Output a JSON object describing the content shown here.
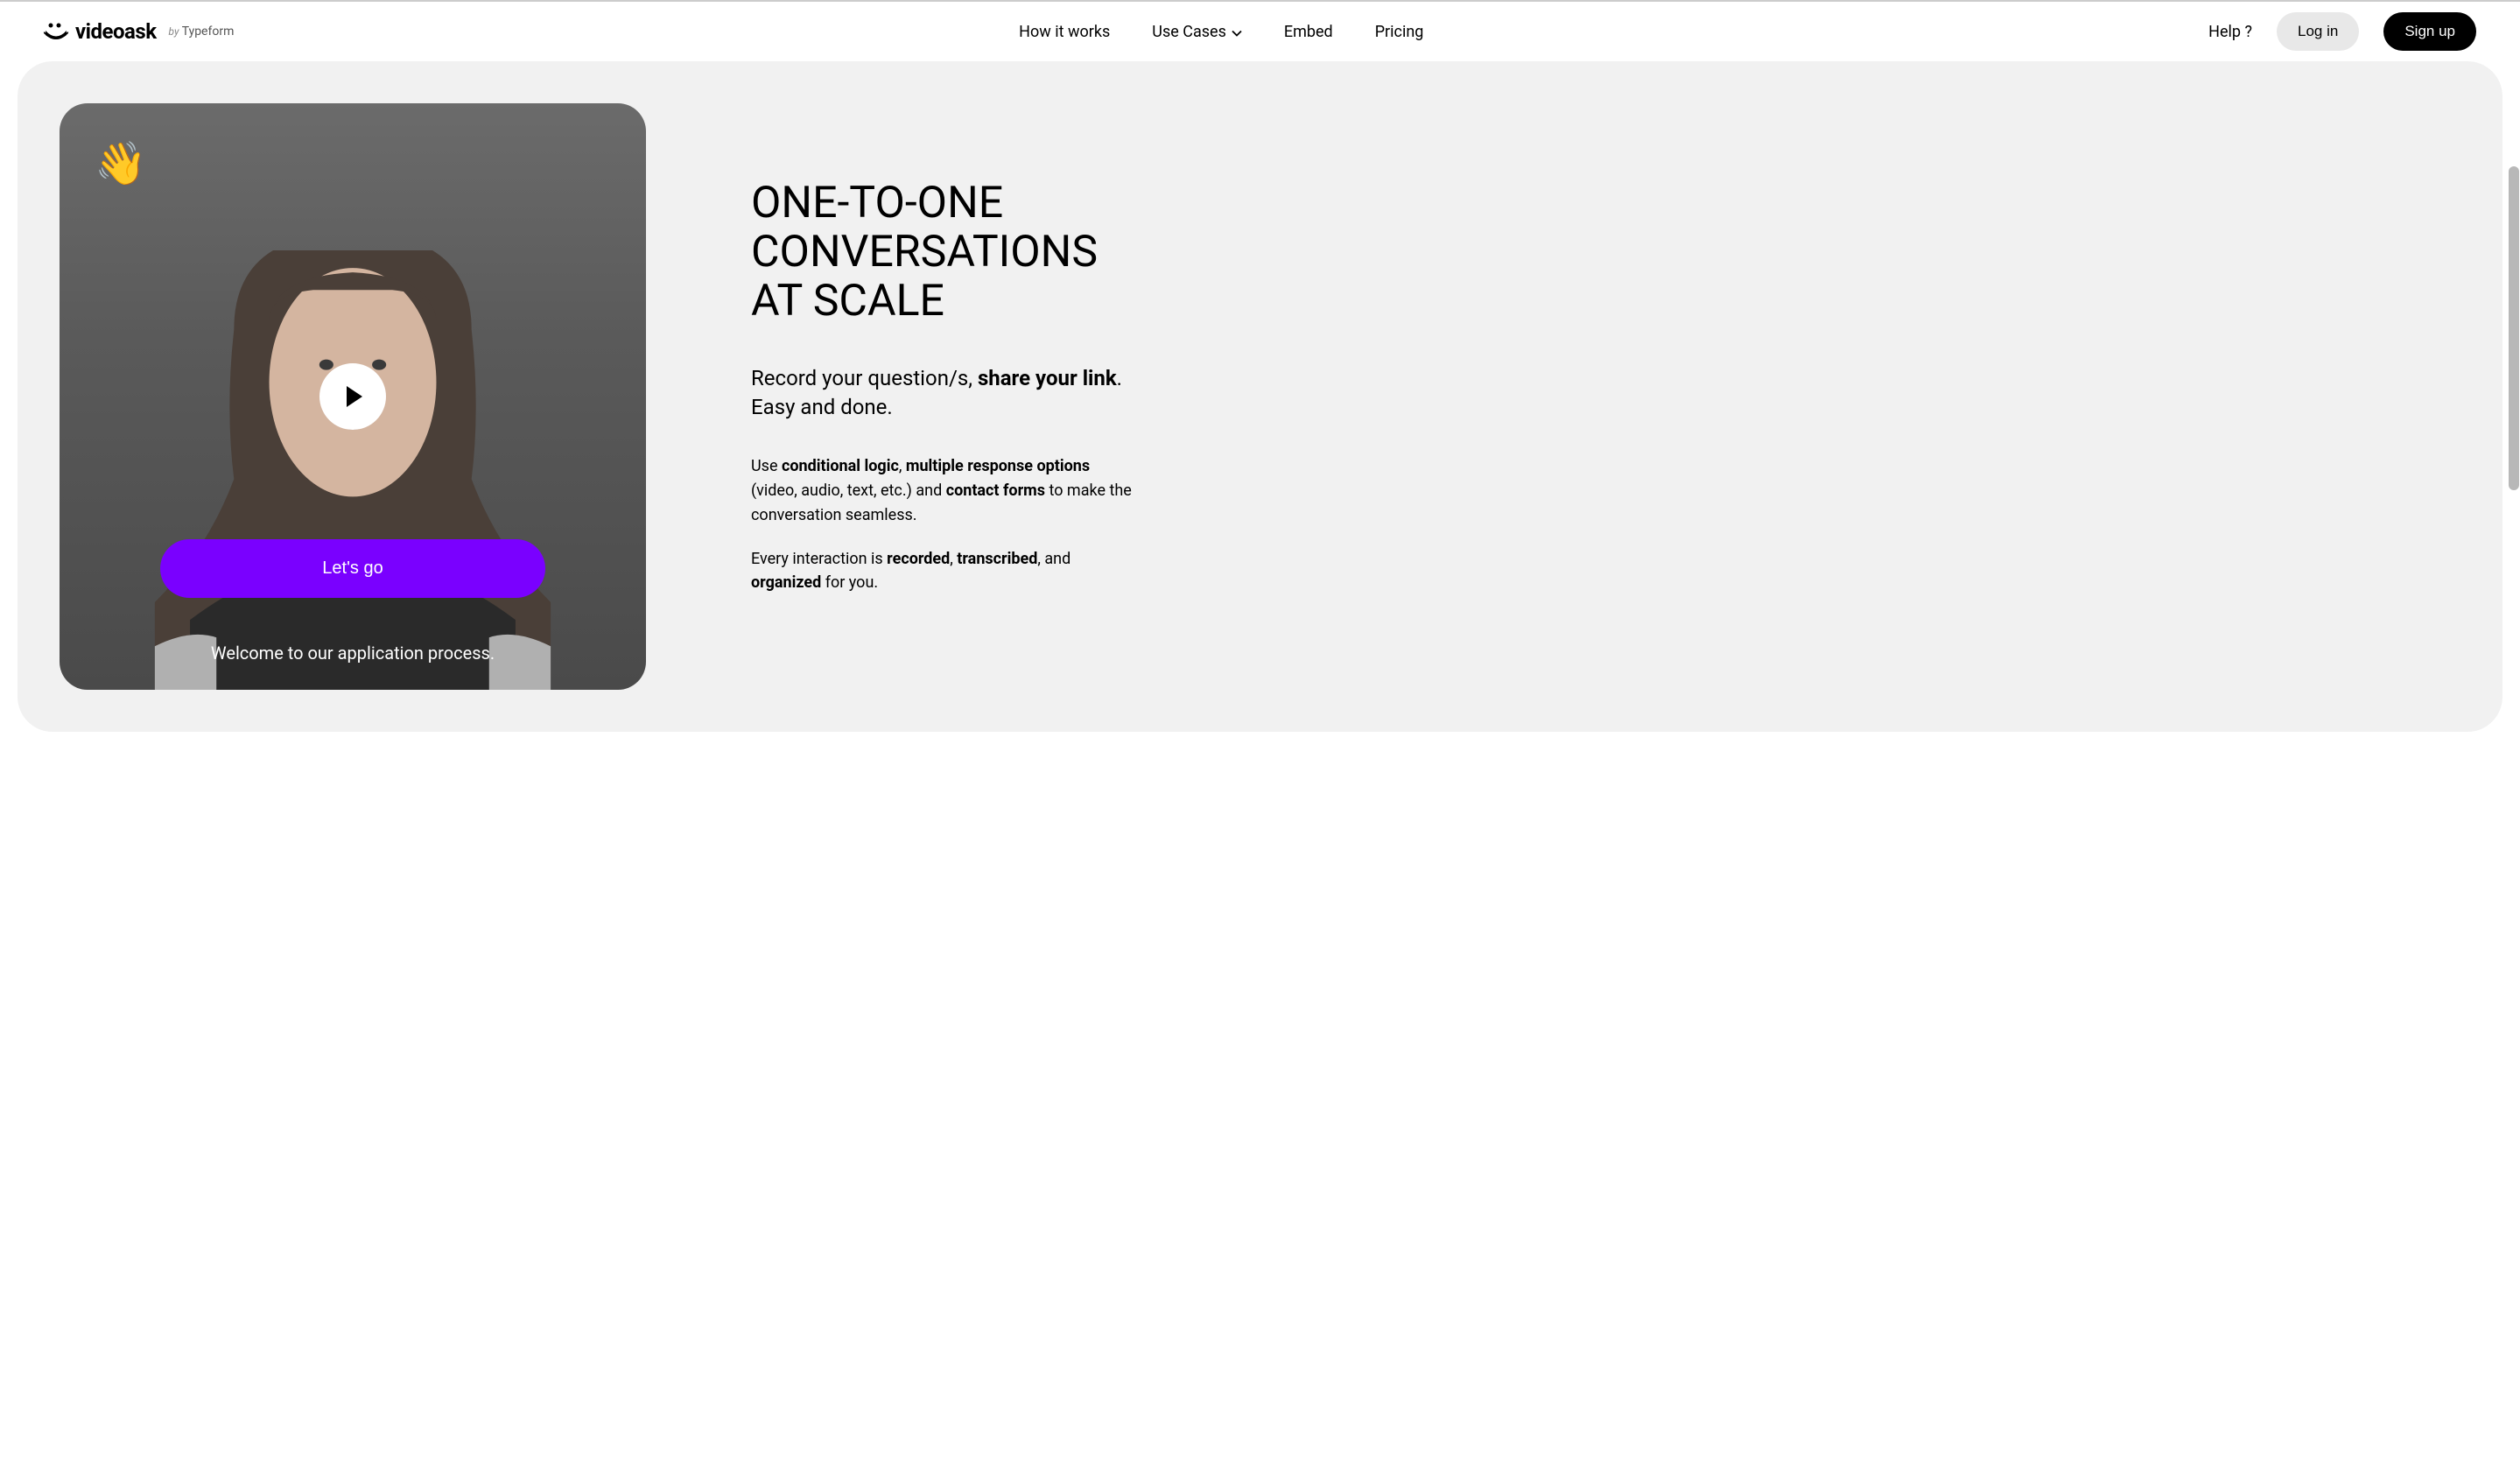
{
  "header": {
    "brand_name": "videoask",
    "byline_prefix": "by",
    "byline_company": "Typeform",
    "nav": {
      "how_it_works": "How it works",
      "use_cases": "Use Cases",
      "embed": "Embed",
      "pricing": "Pricing"
    },
    "help": "Help ?",
    "login": "Log in",
    "signup": "Sign up"
  },
  "hero": {
    "wave_emoji": "👋",
    "cta_button": "Let's go",
    "caption": "Welcome to our application process.",
    "headline": "ONE-TO-ONE CONVERSATIONS AT SCALE",
    "subhead_pre": "Record your question/s, ",
    "subhead_bold": "share your link",
    "subhead_post": ". Easy and done.",
    "body1_pre": "Use ",
    "body1_b1": "conditional logic",
    "body1_mid1": ", ",
    "body1_b2": "multiple response options",
    "body1_mid2": " (video, audio, text, etc.) and ",
    "body1_b3": "contact forms",
    "body1_post": " to make the conversation seamless.",
    "body2_pre": "Every interaction is ",
    "body2_b1": "recorded",
    "body2_mid1": ", ",
    "body2_b2": "transcribed",
    "body2_mid2": ", and ",
    "body2_b3": "organized",
    "body2_post": " for you."
  }
}
